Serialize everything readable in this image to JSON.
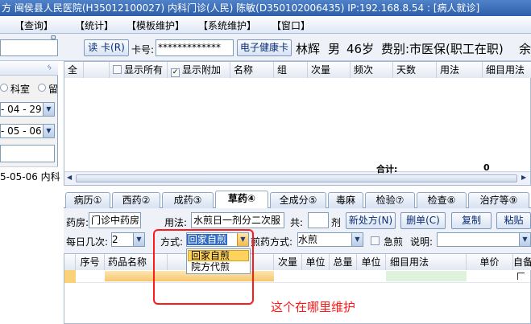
{
  "window": {
    "title": "方  闽侯县人民医院(H35012100027)  内科门诊(人民)  陈敏(D350102006435) IP:192.168.8.54 : [病人就诊]"
  },
  "menubar": {
    "items": [
      "【查询】",
      "【统计】",
      "【模板维护】",
      "【系统维护】",
      "【窗口】"
    ]
  },
  "toolbar": {
    "pin_glyph": "ㅁ",
    "read_card_label": "读 卡(R)",
    "card_no_label": "卡号:",
    "card_no_value": "*************",
    "health_card_label": "电子健康卡",
    "patient_name": "林辉",
    "gender": "男",
    "age": "46岁",
    "fee_type": "费别:市医保(职工在职)",
    "balance_label": "余"
  },
  "left_panel": {
    "pin_glyph": "ᛃ",
    "radio_dept": "科室",
    "radio_other": "留",
    "date_from": "- 04 - 29",
    "date_to": "- 05 - 06",
    "record_date": "5-05-06",
    "record_dept": "内科"
  },
  "upper_grid": {
    "columns": [
      "全",
      "显示所有",
      "显示附加",
      "名称",
      "组",
      "次量",
      "频次",
      "天数",
      "用法",
      "细目用法"
    ],
    "show_all_checked": false,
    "show_extra_checked": true,
    "total_label": "合计:",
    "total_value": "0"
  },
  "tabs": [
    {
      "label": "病历①",
      "active": false
    },
    {
      "label": "西药②",
      "active": false
    },
    {
      "label": "成药③",
      "active": false
    },
    {
      "label": "草药④",
      "active": true
    },
    {
      "label": "全成分⑤",
      "active": false
    },
    {
      "label": "毒麻",
      "active": false
    },
    {
      "label": "检验⑦",
      "active": false
    },
    {
      "label": "检查⑧",
      "active": false
    },
    {
      "label": "治疗等⑨",
      "active": false
    }
  ],
  "herb": {
    "pharmacy_label": "药房:",
    "pharmacy_value": "门诊中药房",
    "usage_label": "用法:",
    "usage_value": "水煎日一剂分二次服",
    "dose_label": "共:",
    "dose_value": "",
    "dose_unit": "剂",
    "new_rx_label": "新处方(N)",
    "del_rx_label": "删单(C)",
    "copy_label": "复制",
    "paste_label": "粘贴",
    "times_label": "每日几次:",
    "times_value": "2",
    "method_label": "方式:",
    "method_value": "回家自煎",
    "decoct_label": "煎药方式:",
    "decoct_value": "水煎",
    "urgent_label": "急煎",
    "urgent_checked": false,
    "note_label": "说明:",
    "note_value": ""
  },
  "method_options": [
    "回家自煎",
    "院方代煎"
  ],
  "lower_grid": {
    "columns": [
      "序号",
      "药品名称",
      "次量",
      "单位",
      "总量",
      "单位",
      "细目用法",
      "单价",
      "自备"
    ]
  },
  "annotation": {
    "text": "这个在哪里维护"
  },
  "colors": {
    "accent": "#2c5fa8",
    "annotation": "#ff1a1a",
    "selected_row": "#fde7b0"
  }
}
